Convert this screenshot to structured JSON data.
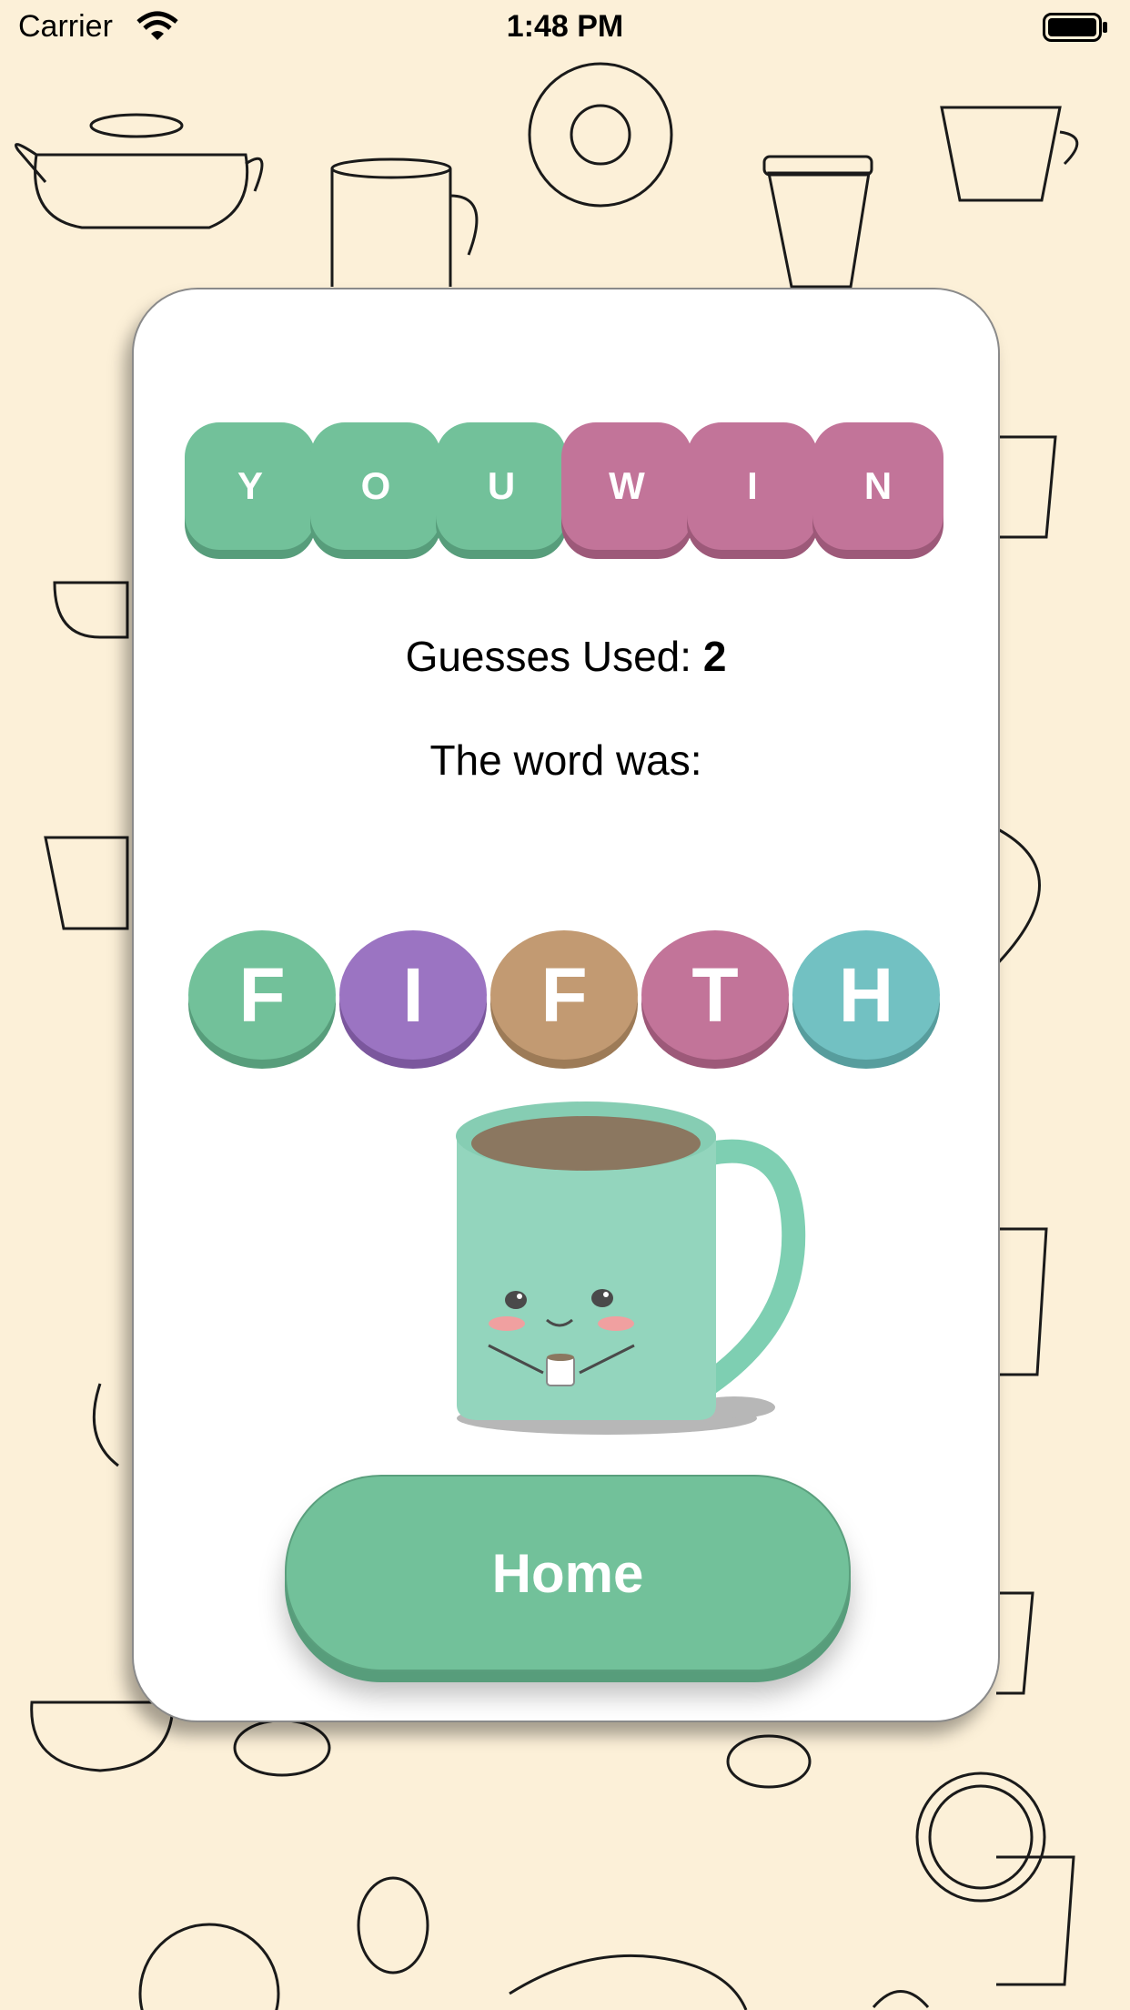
{
  "status_bar": {
    "carrier": "Carrier",
    "time": "1:48 PM"
  },
  "result_tiles": [
    {
      "letter": "Y",
      "color": "green"
    },
    {
      "letter": "O",
      "color": "green"
    },
    {
      "letter": "U",
      "color": "green"
    },
    {
      "letter": "W",
      "color": "pink"
    },
    {
      "letter": "I",
      "color": "pink"
    },
    {
      "letter": "N",
      "color": "pink"
    }
  ],
  "guesses": {
    "label": "Guesses Used:",
    "value": "2"
  },
  "word_label": "The word was:",
  "word_letters": [
    {
      "letter": "F",
      "color": "#72c19a",
      "shade": "#579d7b"
    },
    {
      "letter": "I",
      "color": "#9b74c2",
      "shade": "#7b579d"
    },
    {
      "letter": "F",
      "color": "#c29a72",
      "shade": "#9d7b57"
    },
    {
      "letter": "T",
      "color": "#c27499",
      "shade": "#9d5979"
    },
    {
      "letter": "H",
      "color": "#72c1c2",
      "shade": "#579d9d"
    }
  ],
  "home_button": {
    "label": "Home"
  },
  "colors": {
    "background": "#fcf0d8",
    "green": "#72c19a",
    "pink": "#c27499",
    "mug": "#93d5bd"
  }
}
